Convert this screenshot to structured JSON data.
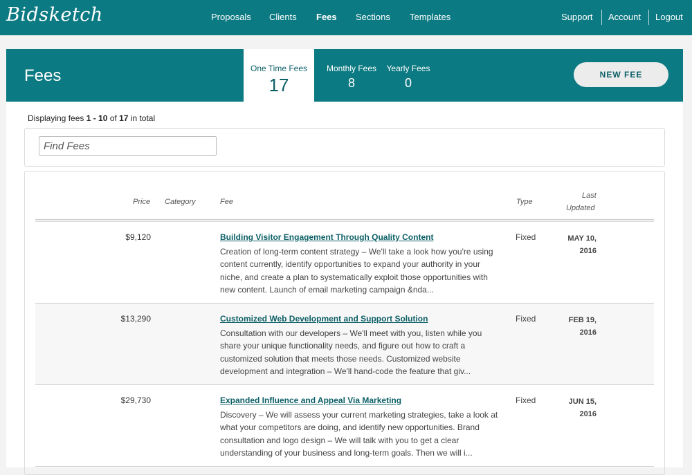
{
  "app": {
    "logo_text": "Bidsketch"
  },
  "nav": {
    "items": [
      "Proposals",
      "Clients",
      "Fees",
      "Sections",
      "Templates"
    ],
    "active": "Fees",
    "right": [
      "Support",
      "Account",
      "Logout"
    ]
  },
  "header": {
    "title": "Fees",
    "tabs": [
      {
        "label": "One Time Fees",
        "count": "17"
      },
      {
        "label": "Monthly Fees",
        "count": "8"
      },
      {
        "label": "Yearly Fees",
        "count": "0"
      }
    ],
    "new_button": "NEW FEE"
  },
  "display": {
    "prefix": "Displaying fees ",
    "range": "1 - 10",
    "of": " of ",
    "total": "17",
    "suffix": " in total"
  },
  "search": {
    "placeholder": "Find Fees"
  },
  "table": {
    "columns": {
      "price": "Price",
      "category": "Category",
      "fee": "Fee",
      "type": "Type",
      "last": "Last",
      "updated": "Updated"
    },
    "rows": [
      {
        "price": "$9,120",
        "category": "",
        "title": "Building Visitor Engagement Through Quality Content",
        "description": "Creation of long-term content strategy – We'll take a look how you're using content currently, identify opportunities to expand your authority in your niche, and create a plan to systematically exploit those opportunities with new content. Launch of email marketing campaign &nda...",
        "type": "Fixed",
        "date": "MAY 10, 2016"
      },
      {
        "price": "$13,290",
        "category": "",
        "title": "Customized Web Development and Support Solution",
        "description": "Consultation with our developers – We'll meet with you, listen while you share your unique functionality needs, and figure out how to craft a customized solution that meets those needs. Customized website development and integration – We'll hand-code the feature that giv...",
        "type": "Fixed",
        "date": "FEB 19, 2016"
      },
      {
        "price": "$29,730",
        "category": "",
        "title": "Expanded Influence and Appeal Via Marketing",
        "description": "Discovery – We will assess your current marketing strategies, take a look at what your competitors are doing, and identify new opportunities. Brand consultation and logo design – We will talk with you to get a clear understanding of your business and long-term goals. Then we will i...",
        "type": "Fixed",
        "date": "JUN 15, 2016"
      }
    ]
  },
  "colors": {
    "brand": "#0c7a82",
    "link": "#0c5f66"
  }
}
